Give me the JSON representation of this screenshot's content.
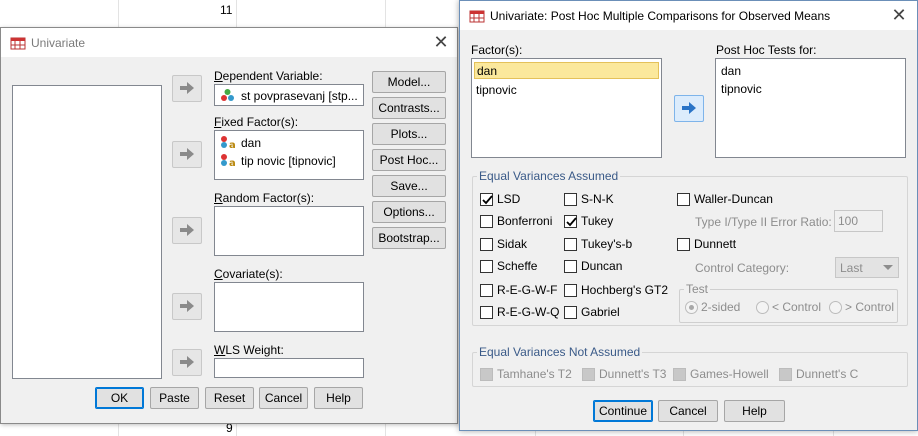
{
  "spreadsheet": {
    "row_top": "11",
    "row_bottom": "9"
  },
  "univariate": {
    "title": "Univariate",
    "dependent": {
      "label_pre": "D",
      "label_rest": "ependent Variable:",
      "value": "st povprasevanj [stp..."
    },
    "fixed": {
      "label_pre": "F",
      "label_rest": "ixed Factor(s):",
      "items": [
        "dan",
        "tip novic [tipnovic]"
      ]
    },
    "random": {
      "label_pre": "R",
      "label_rest": "andom Factor(s):"
    },
    "covariate": {
      "label_pre": "C",
      "label_rest": "ovariate(s):"
    },
    "wls": {
      "label_pre": "W",
      "label_rest": "LS Weight:"
    },
    "side_buttons": [
      "Model...",
      "Contrasts...",
      "Plots...",
      "Post Hoc...",
      "Save...",
      "Options...",
      "Bootstrap..."
    ],
    "bottom_buttons": [
      "OK",
      "Paste",
      "Reset",
      "Cancel",
      "Help"
    ]
  },
  "posthoc": {
    "title": "Univariate: Post Hoc Multiple Comparisons for Observed Means",
    "factors_label": "Factor(s):",
    "factors": [
      "dan",
      "tipnovic"
    ],
    "tests_for_label": "Post Hoc Tests for:",
    "tests_for": [
      "dan",
      "tipnovic"
    ],
    "equal_assumed": {
      "title": "Equal Variances Assumed",
      "col1": [
        {
          "label": "LSD",
          "checked": true
        },
        {
          "label": "Bonferroni",
          "checked": false
        },
        {
          "label": "Sidak",
          "checked": false
        },
        {
          "label": "Scheffe",
          "checked": false
        },
        {
          "label": "R-E-G-W-F",
          "checked": false
        },
        {
          "label": "R-E-G-W-Q",
          "checked": false
        }
      ],
      "col2": [
        {
          "label": "S-N-K",
          "checked": false
        },
        {
          "label": "Tukey",
          "checked": true
        },
        {
          "label": "Tukey's-b",
          "checked": false
        },
        {
          "label": "Duncan",
          "checked": false
        },
        {
          "label": "Hochberg's GT2",
          "checked": false
        },
        {
          "label": "Gabriel",
          "checked": false
        }
      ],
      "waller": "Waller-Duncan",
      "ratio_label": "Type I/Type II Error Ratio:",
      "ratio_value": "100",
      "dunnett": "Dunnett",
      "control_label": "Control Category:",
      "control_value": "Last",
      "test_title": "Test",
      "test_options": [
        "2-sided",
        "< Control",
        "> Control"
      ]
    },
    "equal_not_assumed": {
      "title": "Equal Variances Not Assumed",
      "options": [
        "Tamhane's T2",
        "Dunnett's T3",
        "Games-Howell",
        "Dunnett's C"
      ]
    },
    "buttons": [
      "Continue",
      "Cancel",
      "Help"
    ]
  }
}
